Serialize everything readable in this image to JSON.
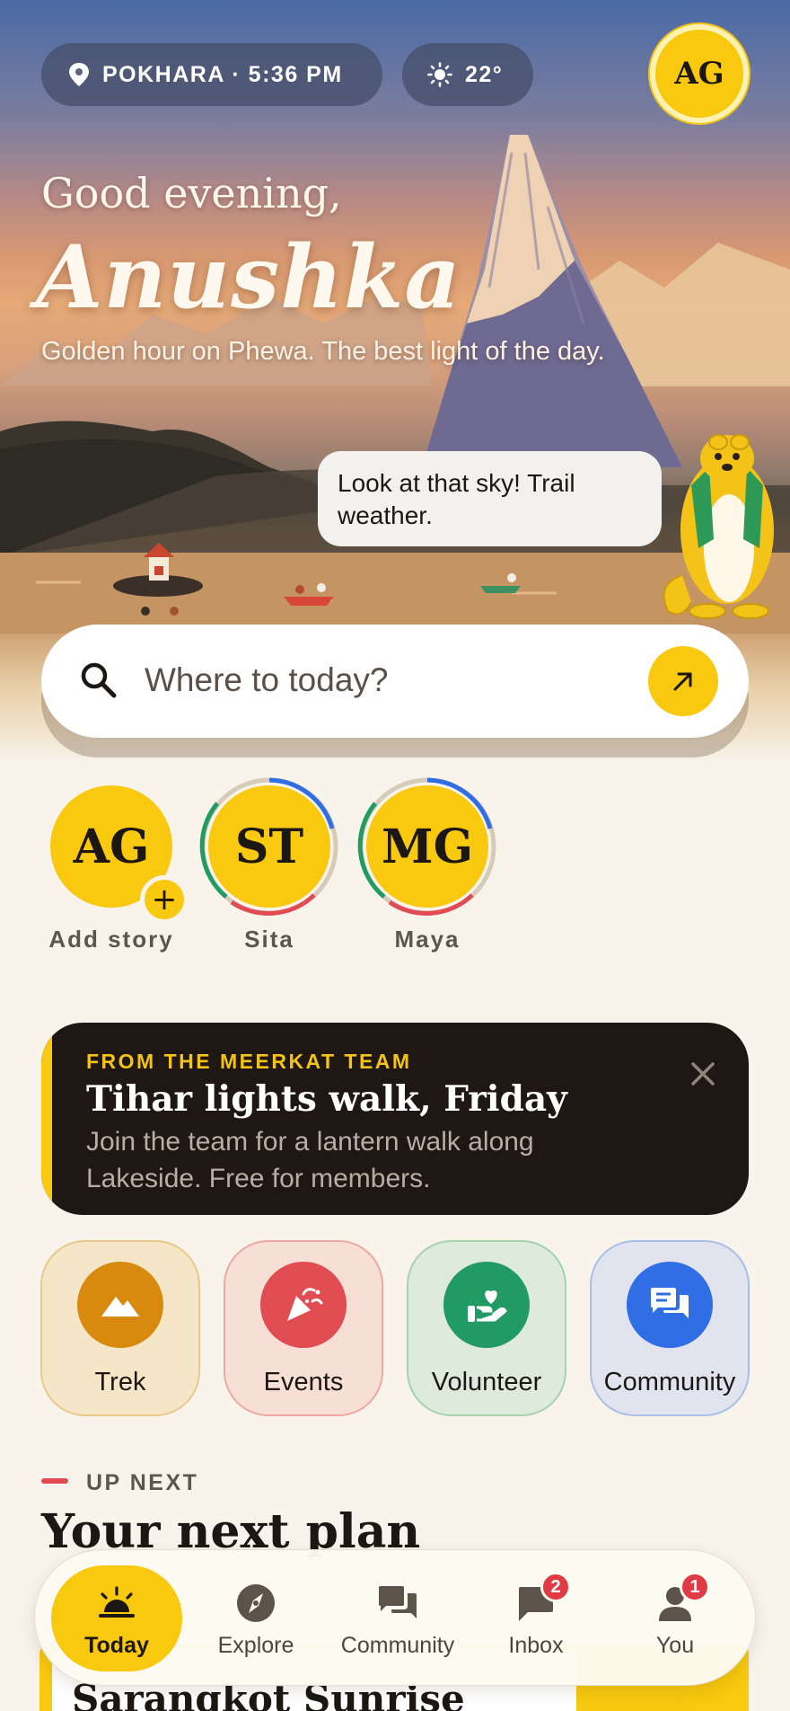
{
  "header": {
    "location_time": "POKHARA · 5:36 PM",
    "temperature": "22°",
    "avatar_initials": "AG"
  },
  "hero": {
    "greeting": "Good evening,",
    "name": "Anushka",
    "tagline": "Golden hour on Phewa. The best light of the day.",
    "mascot_bubble": "Look at that sky! Trail weather."
  },
  "search": {
    "placeholder": "Where to today?"
  },
  "stories": [
    {
      "initials": "AG",
      "label": "Add story"
    },
    {
      "initials": "ST",
      "label": "Sita"
    },
    {
      "initials": "MG",
      "label": "Maya"
    }
  ],
  "promo": {
    "kicker": "FROM THE MEERKAT TEAM",
    "title": "Tihar lights walk, Friday",
    "body": "Join the team for a lantern walk along Lakeside. Free for members."
  },
  "categories": [
    {
      "label": "Trek",
      "icon": "mountain-icon"
    },
    {
      "label": "Events",
      "icon": "party-popper-icon"
    },
    {
      "label": "Volunteer",
      "icon": "heart-hand-icon"
    },
    {
      "label": "Community",
      "icon": "chat-bubbles-icon"
    }
  ],
  "upnext": {
    "kicker": "UP NEXT",
    "title": "Your next plan",
    "plan_name": "Sarangkot Sunrise"
  },
  "nav": {
    "items": [
      {
        "label": "Today",
        "icon": "sunrise-icon"
      },
      {
        "label": "Explore",
        "icon": "compass-icon"
      },
      {
        "label": "Community",
        "icon": "chat-bubbles-icon"
      },
      {
        "label": "Inbox",
        "icon": "message-icon",
        "badge": "2"
      },
      {
        "label": "You",
        "icon": "person-icon",
        "badge": "1"
      }
    ]
  },
  "colors": {
    "accent_yellow": "#f8c90f",
    "promo_bg": "#1e1713",
    "alert_red": "#e03a44"
  }
}
